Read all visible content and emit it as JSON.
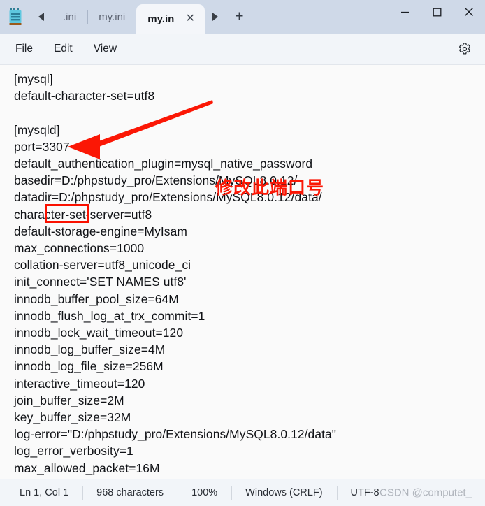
{
  "window": {
    "app_icon": "notepad-icon",
    "controls": {
      "minimize": "minimize-icon",
      "maximize": "maximize-icon",
      "close": "close-icon"
    }
  },
  "tabs": {
    "scroll_left": "chevron-left-icon",
    "scroll_right": "chevron-right-icon",
    "new_tab_label": "+",
    "items": [
      {
        "label": ".ini",
        "active": false
      },
      {
        "label": "my.ini",
        "active": false
      },
      {
        "label": "my.in",
        "active": true,
        "close_label": "✕"
      }
    ]
  },
  "menubar": {
    "items": [
      {
        "label": "File"
      },
      {
        "label": "Edit"
      },
      {
        "label": "View"
      }
    ],
    "settings_icon": "gear-icon"
  },
  "editor": {
    "content": "[mysql]\ndefault-character-set=utf8\n\n[mysqld]\nport=3307\ndefault_authentication_plugin=mysql_native_password\nbasedir=D:/phpstudy_pro/Extensions/MySQL8.0.12/\ndatadir=D:/phpstudy_pro/Extensions/MySQL8.0.12/data/\ncharacter-set-server=utf8\ndefault-storage-engine=MyIsam\nmax_connections=1000\ncollation-server=utf8_unicode_ci\ninit_connect='SET NAMES utf8'\ninnodb_buffer_pool_size=64M\ninnodb_flush_log_at_trx_commit=1\ninnodb_lock_wait_timeout=120\ninnodb_log_buffer_size=4M\ninnodb_log_file_size=256M\ninteractive_timeout=120\njoin_buffer_size=2M\nkey_buffer_size=32M\nlog-error=\"D:/phpstudy_pro/Extensions/MySQL8.0.12/data\"\nlog_error_verbosity=1\nmax_allowed_packet=16M"
  },
  "annotation": {
    "text": "修改此端口号",
    "color": "#fb1705",
    "highlighted_value": "3307",
    "arrow": "red-arrow-pointing-left"
  },
  "statusbar": {
    "cursor": "Ln 1, Col 1",
    "characters": "968 characters",
    "zoom": "100%",
    "line_ending": "Windows (CRLF)",
    "encoding": "UTF-8",
    "watermark": "CSDN @computet_"
  }
}
